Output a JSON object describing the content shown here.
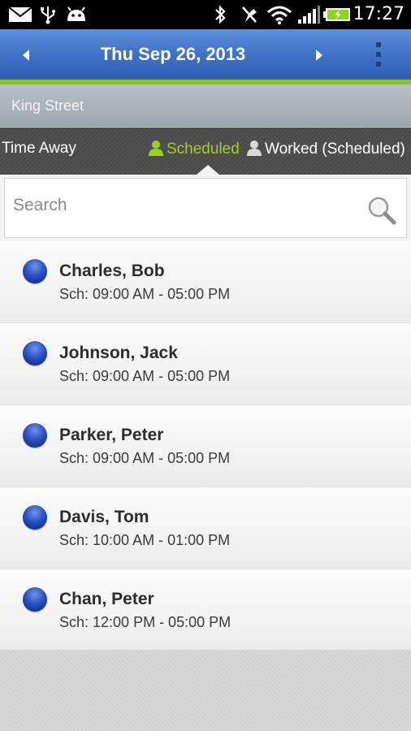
{
  "status_bar": {
    "time": "17:27",
    "icons": [
      "mail-icon",
      "usb-icon",
      "android-icon",
      "bluetooth-icon",
      "mute-icon",
      "wifi-icon",
      "signal-icon",
      "battery-charging-icon"
    ]
  },
  "action_bar": {
    "date_title": "Thu Sep 26, 2013",
    "prev_icon": "chevron-left-icon",
    "next_icon": "chevron-right-icon",
    "overflow_icon": "overflow-menu-icon"
  },
  "location": {
    "name": "King Street"
  },
  "tabs": [
    {
      "label": "Time Away",
      "active": false
    },
    {
      "label": "Scheduled",
      "active": true,
      "icon": "person-icon"
    },
    {
      "label": "Worked (Scheduled)",
      "active": false,
      "icon": "person-icon"
    }
  ],
  "search": {
    "placeholder": "Search",
    "value": ""
  },
  "employees": [
    {
      "name": "Charles, Bob",
      "schedule": "Sch: 09:00 AM - 05:00 PM"
    },
    {
      "name": "Johnson, Jack",
      "schedule": "Sch: 09:00 AM - 05:00 PM"
    },
    {
      "name": "Parker, Peter",
      "schedule": "Sch: 09:00 AM - 05:00 PM"
    },
    {
      "name": "Davis, Tom",
      "schedule": "Sch: 10:00 AM - 01:00 PM"
    },
    {
      "name": "Chan, Peter",
      "schedule": "Sch: 12:00 PM - 05:00 PM"
    }
  ],
  "colors": {
    "action_bar": "#3d6fc4",
    "accent_green": "#8ec31f",
    "active_tab": "#9bd21c",
    "status_dot": "#2a52c4"
  }
}
